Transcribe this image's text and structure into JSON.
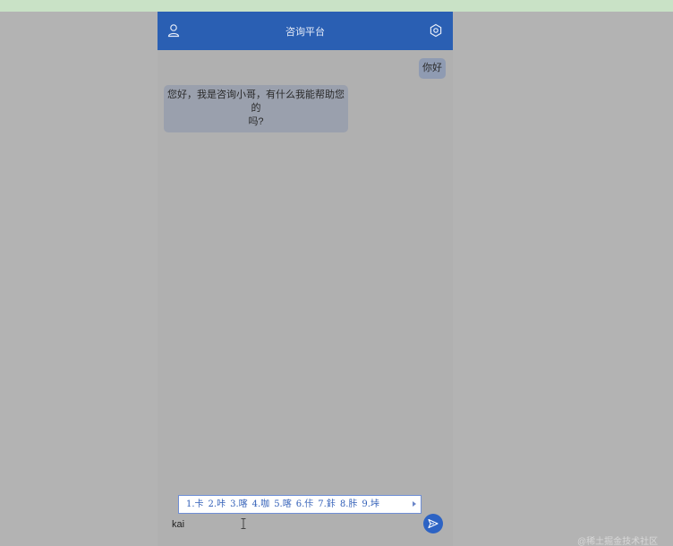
{
  "header": {
    "title": "咨询平台",
    "left_icon": "user-icon",
    "right_icon": "settings-icon"
  },
  "messages": [
    {
      "from": "user",
      "text": "你好"
    },
    {
      "from": "bot",
      "text_line1": "您好，我是咨询小哥，有什么我能帮助您的",
      "text_line2": "吗?"
    }
  ],
  "ime": {
    "candidates": [
      "1.卡",
      "2.咔",
      "3.喀",
      "4.咖",
      "5.喀",
      "6.佧",
      "7.鉲",
      "8.胩",
      "9.垰"
    ],
    "next_icon": "chevron-right-icon"
  },
  "input": {
    "value": "kai"
  },
  "send_button": {
    "icon": "send-icon"
  },
  "watermark": "@稀土掘金技术社区",
  "colors": {
    "header_bg": "#2a5fb3",
    "send_bg": "#2d63c4",
    "user_bubble": "#8f9bb2",
    "bot_bubble": "#9aa0ad",
    "overlay": "#b3b3b3"
  }
}
